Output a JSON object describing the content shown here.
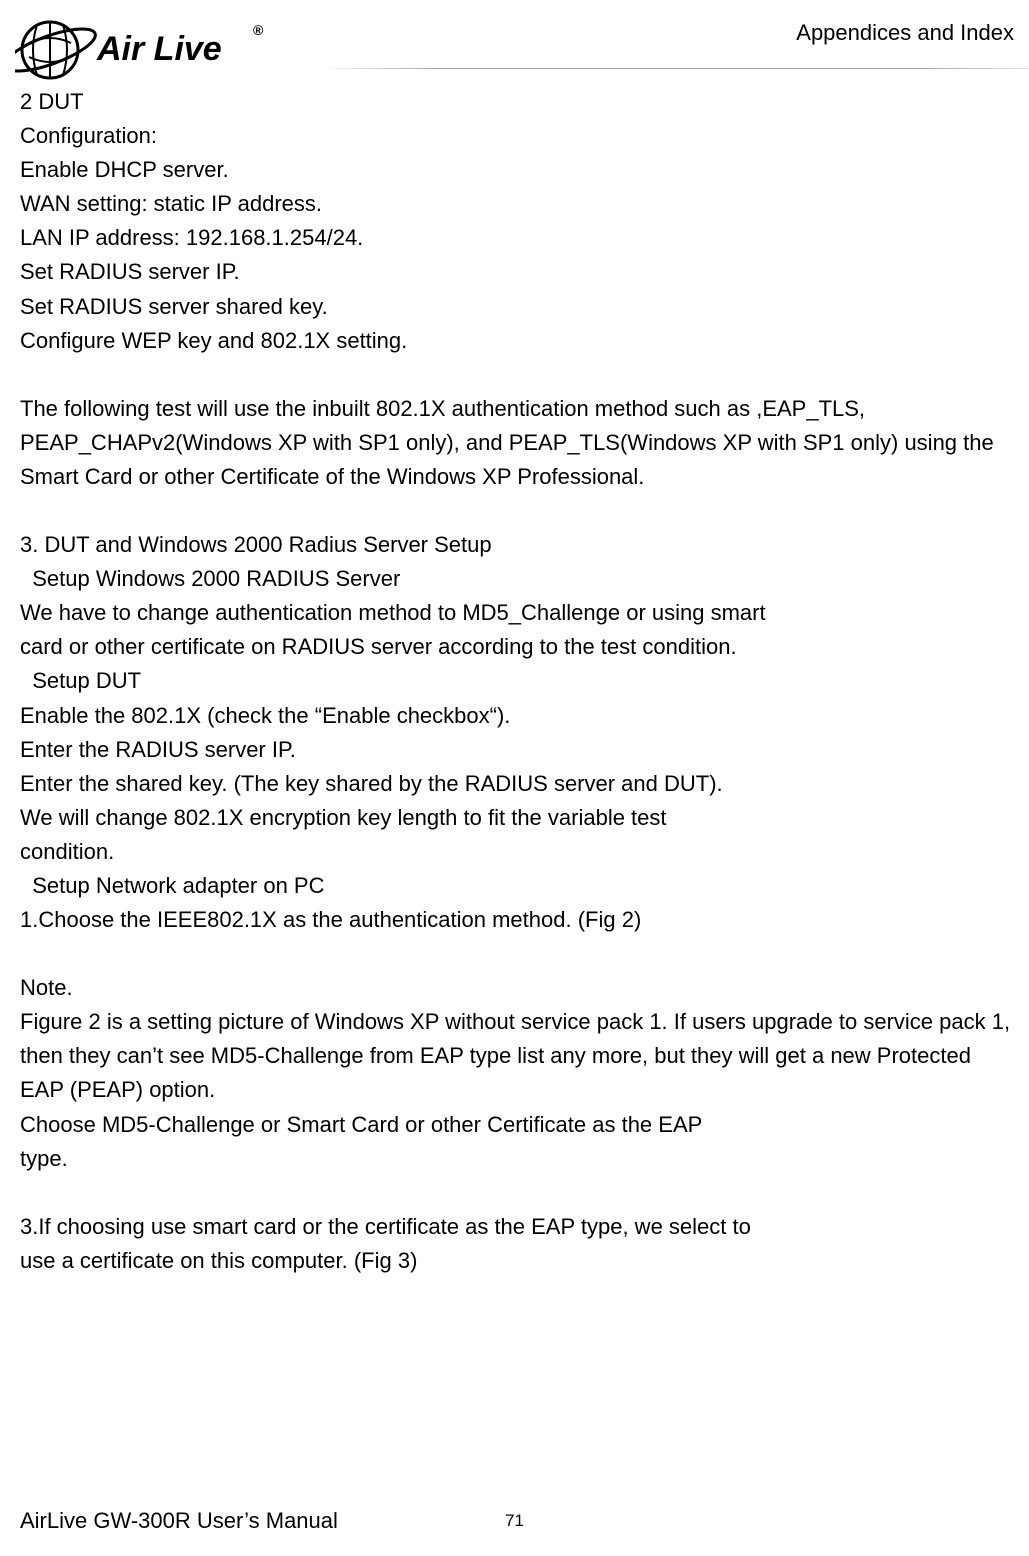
{
  "header": {
    "sectionTitle": "Appendices and Index"
  },
  "logo": {
    "name": "Air Live",
    "iconName": "airlive-planet-icon"
  },
  "content": {
    "line1": "2 DUT",
    "line2": "Configuration:",
    "line3": "Enable DHCP server.",
    "line4": "WAN setting: static IP address.",
    "line5": "LAN IP address: 192.168.1.254/24.",
    "line6": "Set RADIUS server IP.",
    "line7": "Set RADIUS server shared key.",
    "line8": "Configure WEP key and 802.1X setting.",
    "para2a": "The following test will use the inbuilt 802.1X authentication method such as ,EAP_TLS, PEAP_CHAPv2(Windows XP with SP1 only), and PEAP_TLS(Windows XP with SP1 only) using the Smart Card or other Certificate of the Windows XP Professional.",
    "line9": "3. DUT and Windows 2000 Radius Server Setup",
    "line10": "  Setup Windows 2000 RADIUS Server",
    "line11": "We have to change authentication method to MD5_Challenge or using smart",
    "line12": "card or other certificate on RADIUS server according to the test condition.",
    "line13": "  Setup DUT",
    "line14": "Enable the 802.1X (check the “Enable checkbox“).",
    "line15": "Enter the RADIUS server IP.",
    "line16": "Enter the shared key. (The key shared by the RADIUS server and DUT).",
    "line17": "We will change 802.1X encryption key length to fit the variable test",
    "line18": "condition.",
    "line19": "  Setup Network adapter on PC",
    "line20": "1.Choose the IEEE802.1X as the authentication method. (Fig 2)",
    "line21": "Note.",
    "para3": "Figure 2 is a setting picture of Windows XP without service pack 1. If users upgrade to service pack 1, then they can’t see MD5-Challenge from EAP type list any more, but they will get a new Protected EAP (PEAP) option.",
    "line22": "Choose MD5-Challenge or Smart Card or other Certificate as the EAP",
    "line23": "type.",
    "line24": "3.If choosing use smart card or the certificate as the EAP type, we select to",
    "line25": "use a certificate on this computer. (Fig 3)"
  },
  "footer": {
    "manualTitle": "AirLive GW-300R User’s Manual",
    "pageNumber": "71"
  }
}
